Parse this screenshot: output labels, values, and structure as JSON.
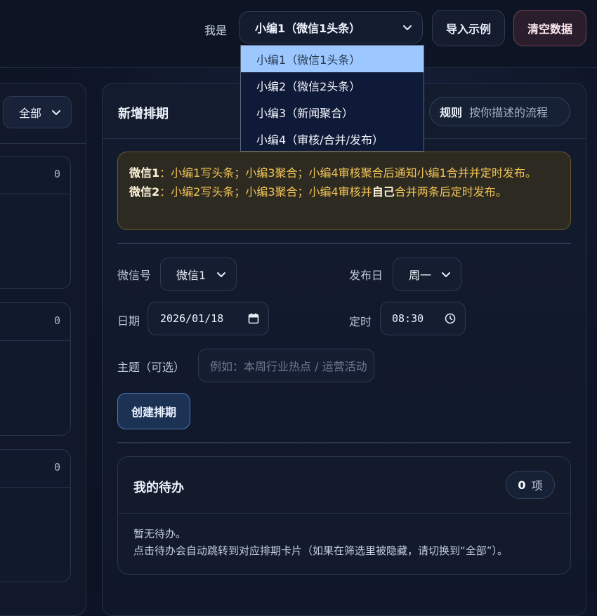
{
  "header": {
    "whoami_label": "我是",
    "role_selected": "小编1（微信1头条）",
    "import_button": "导入示例",
    "clear_button": "清空数据"
  },
  "role_dropdown": {
    "options": [
      "小编1（微信1头条）",
      "小编2（微信2头条）",
      "小编3（新闻聚合）",
      "小编4（审核/合并/发布）"
    ],
    "selected_index": 0
  },
  "left_panel": {
    "filter_value": "全部",
    "cards": [
      {
        "count": "0"
      },
      {
        "count": "0"
      },
      {
        "count": "0"
      }
    ]
  },
  "main": {
    "title": "新增排期",
    "rules_key": "规则",
    "rules_value": "按你描述的流程",
    "notice": {
      "line1_label": "微信1",
      "line1_text": "：小编1写头条；小编3聚合；小编4审核聚合后通知小编1合并并定时发布。",
      "line2_label": "微信2",
      "line2_text_a": "：小编2写头条；小编3聚合；小编4审核并",
      "line2_bold": "自己",
      "line2_text_b": "合并两条后定时发布。"
    },
    "form": {
      "account_label": "微信号",
      "account_value": "微信1",
      "weekday_label": "发布日",
      "weekday_value": "周一",
      "date_label": "日期",
      "date_value": "2026/01/18",
      "time_label": "定时",
      "time_value": "08:30",
      "topic_label": "主题（可选）",
      "topic_placeholder": "例如：本周行业热点 / 运营活动"
    },
    "create_button": "创建排期",
    "todo": {
      "title": "我的待办",
      "count": "0",
      "count_unit": "项",
      "empty_line1": "暂无待办。",
      "empty_line2": "点击待办会自动跳转到对应排期卡片（如果在筛选里被隐藏，请切换到“全部”）。"
    }
  },
  "colors": {
    "accent_blue": "#9cc8ff",
    "notice_text": "#f2c356",
    "danger_border": "#7a3f56"
  }
}
